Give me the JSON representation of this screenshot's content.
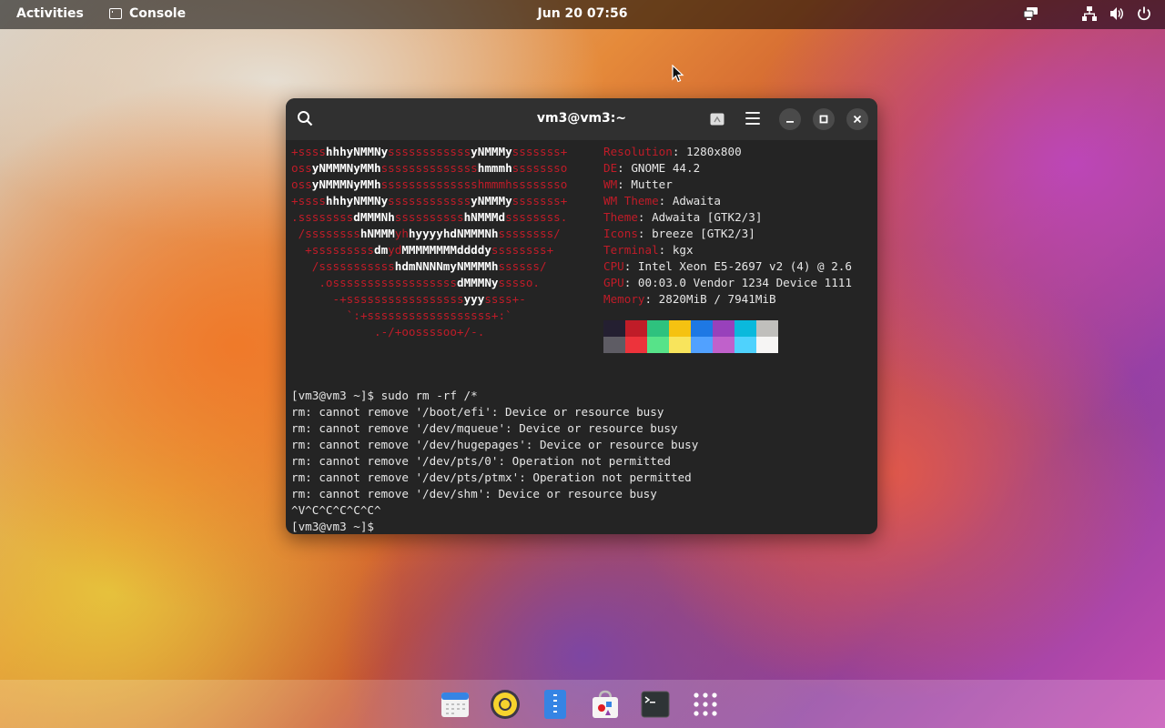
{
  "topbar": {
    "activities": "Activities",
    "app_name": "Console",
    "clock": "Jun 20  07:56",
    "tray_icons": [
      "display-icon",
      "network-icon",
      "volume-icon",
      "power-icon"
    ]
  },
  "window": {
    "title": "vm3@vm3:~",
    "buttons": [
      "search-icon",
      "new-tab-icon",
      "menu-icon",
      "minimize-icon",
      "maximize-icon",
      "close-icon"
    ]
  },
  "neofetch": {
    "logo_lines": [
      [
        [
          "r",
          "+ssss"
        ],
        [
          "w",
          "hhhyNMMNy"
        ],
        [
          "r",
          "ssssssssssss"
        ],
        [
          "w",
          "yNMMMy"
        ],
        [
          "r",
          "sssssss+"
        ]
      ],
      [
        [
          "r",
          "oss"
        ],
        [
          "w",
          "yNMMMNyMMh"
        ],
        [
          "r",
          "ssssssssssssss"
        ],
        [
          "w",
          "hmmmh"
        ],
        [
          "r",
          "ssssssso"
        ]
      ],
      [
        [
          "r",
          "oss"
        ],
        [
          "w",
          "yNMMMNyMMh"
        ],
        [
          "r",
          "ssssssssssssss"
        ],
        [
          "r",
          "hmmmh"
        ],
        [
          "r",
          "ssssssso"
        ]
      ],
      [
        [
          "r",
          "+ssss"
        ],
        [
          "w",
          "hhhyNMMNy"
        ],
        [
          "r",
          "ssssssssssss"
        ],
        [
          "w",
          "yNMMMy"
        ],
        [
          "r",
          "sssssss+"
        ]
      ],
      [
        [
          "r",
          ".ssssssss"
        ],
        [
          "w",
          "dMMMNh"
        ],
        [
          "r",
          "ssssssssss"
        ],
        [
          "w",
          "hNMMMd"
        ],
        [
          "r",
          "ssssssss."
        ]
      ],
      [
        [
          "r",
          " /ssssssss"
        ],
        [
          "w",
          "hNMMM"
        ],
        [
          "r",
          "yh"
        ],
        [
          "w",
          "hyyyyhdNMMMNh"
        ],
        [
          "r",
          "ssssssss/"
        ]
      ],
      [
        [
          "r",
          "  +sssssssss"
        ],
        [
          "w",
          "dm"
        ],
        [
          "r",
          "yd"
        ],
        [
          "w",
          "MMMMMMMMddddy"
        ],
        [
          "r",
          "ssssssss+"
        ]
      ],
      [
        [
          "r",
          "   /sssssssssss"
        ],
        [
          "w",
          "hdmNNNNmyNMMMMh"
        ],
        [
          "r",
          "ssssss/"
        ]
      ],
      [
        [
          "r",
          "    .ossssssssssssssssss"
        ],
        [
          "w",
          "dMMMNy"
        ],
        [
          "r",
          "sssso."
        ]
      ],
      [
        [
          "r",
          "      -+sssssssssssssssss"
        ],
        [
          "w",
          "yyy"
        ],
        [
          "r",
          "ssss+-"
        ]
      ],
      [
        [
          "r",
          "        `:+ssssssssssssssssss+:`"
        ]
      ],
      [
        [
          "r",
          "            .-/+oossssoo+/-."
        ]
      ]
    ],
    "info": [
      {
        "key": "Resolution",
        "value": "1280x800"
      },
      {
        "key": "DE",
        "value": "GNOME 44.2"
      },
      {
        "key": "WM",
        "value": "Mutter"
      },
      {
        "key": "WM Theme",
        "value": "Adwaita"
      },
      {
        "key": "Theme",
        "value": "Adwaita [GTK2/3]"
      },
      {
        "key": "Icons",
        "value": "breeze [GTK2/3]"
      },
      {
        "key": "Terminal",
        "value": "kgx"
      },
      {
        "key": "CPU",
        "value": "Intel Xeon E5-2697 v2 (4) @ 2.6"
      },
      {
        "key": "GPU",
        "value": "00:03.0 Vendor 1234 Device 1111"
      },
      {
        "key": "Memory",
        "value": "2820MiB / 7941MiB"
      }
    ],
    "palette_row1": [
      "#241f31",
      "#c01c28",
      "#2ec27e",
      "#f5c211",
      "#1e78e4",
      "#9841bb",
      "#0ab9dc",
      "#c0bfbc"
    ],
    "palette_row2": [
      "#5e5c64",
      "#ed333b",
      "#57e389",
      "#f8e45c",
      "#51a1ff",
      "#c061cb",
      "#4fd2fd",
      "#f6f5f4"
    ]
  },
  "terminal_output": [
    "[vm3@vm3 ~]$ sudo rm -rf /*",
    "rm: cannot remove '/boot/efi': Device or resource busy",
    "rm: cannot remove '/dev/mqueue': Device or resource busy",
    "rm: cannot remove '/dev/hugepages': Device or resource busy",
    "rm: cannot remove '/dev/pts/0': Operation not permitted",
    "rm: cannot remove '/dev/pts/ptmx': Operation not permitted",
    "rm: cannot remove '/dev/shm': Device or resource busy",
    "^V^C^C^C^C^C^",
    "[vm3@vm3 ~]$ "
  ],
  "dock": {
    "items": [
      "calendar-icon",
      "rhythmbox-icon",
      "text-editor-icon",
      "software-icon",
      "terminal-icon",
      "app-grid-icon"
    ]
  }
}
